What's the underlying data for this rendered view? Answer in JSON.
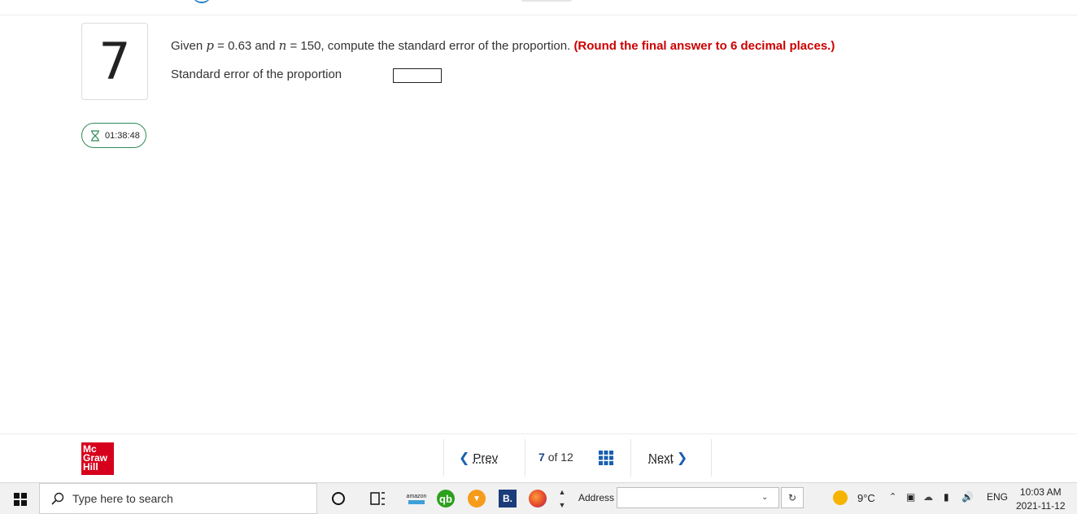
{
  "question": {
    "number": "7",
    "text_given": "Given ",
    "var_p": "p",
    "eq_p": " = 0.63 and ",
    "var_n": "n",
    "eq_n": " = 150, compute the standard error of the proportion. ",
    "instruction": "(Round the final answer to 6 decimal places.)",
    "answer_label": "Standard error of the proportion",
    "answer_value": ""
  },
  "timer": {
    "value": "01:38:48"
  },
  "brand": {
    "line1": "Mc",
    "line2": "Graw",
    "line3": "Hill"
  },
  "nav": {
    "prev_label": "Prev",
    "current": "7",
    "of_label": "of",
    "total": "12",
    "next_label": "Next"
  },
  "taskbar": {
    "search_placeholder": "Type here to search",
    "address_label": "Address",
    "address_value": "",
    "temperature": "9°C",
    "language": "ENG",
    "time": "10:03 AM",
    "date": "2021-11-12",
    "amazon_label": "amazon",
    "qb_label": "qb",
    "b_label": "B."
  },
  "colors": {
    "accent_red": "#cc0000",
    "brand_red": "#d6001c",
    "nav_blue": "#1a5fb0",
    "timer_green": "#2e8b57"
  }
}
